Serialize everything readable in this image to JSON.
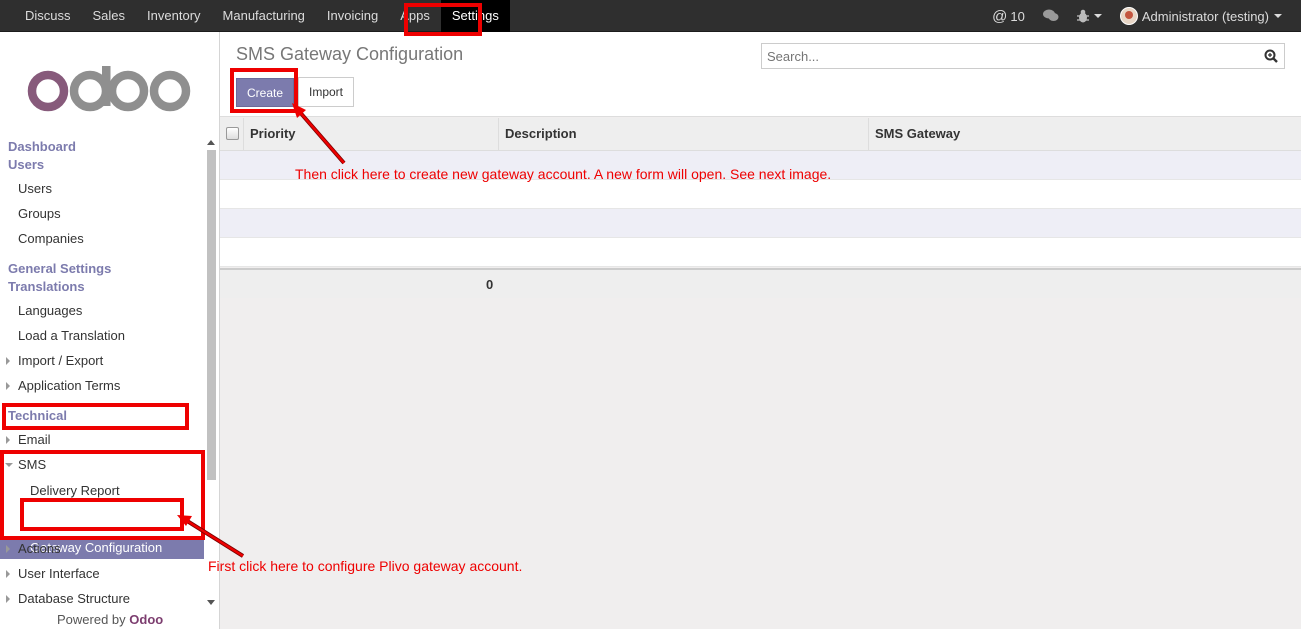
{
  "topbar": {
    "menu": [
      "Discuss",
      "Sales",
      "Inventory",
      "Manufacturing",
      "Invoicing",
      "Apps",
      "Settings"
    ],
    "active": "Settings",
    "mentions": "10",
    "user": "Administrator (testing)"
  },
  "sidebar": {
    "logo": "odoo",
    "dashboard": "Dashboard",
    "users_section": "Users",
    "users_items": [
      "Users",
      "Groups",
      "Companies"
    ],
    "general_settings": "General Settings",
    "translations_section": "Translations",
    "translations_items": [
      "Languages",
      "Load a Translation",
      "Import / Export",
      "Application Terms"
    ],
    "technical": "Technical",
    "email": "Email",
    "sms": "SMS",
    "sms_items": [
      "Delivery Report",
      "Gateway Configuration"
    ],
    "more_items": [
      "Actions",
      "User Interface",
      "Database Structure"
    ],
    "powered_by": "Powered by",
    "powered_brand": "Odoo"
  },
  "main": {
    "title": "SMS Gateway Configuration",
    "search_placeholder": "Search...",
    "create_label": "Create",
    "import_label": "Import",
    "columns": [
      "Priority",
      "Description",
      "SMS Gateway"
    ],
    "footer_total": "0"
  },
  "annotations": {
    "note_create": "Then click here to create new gateway account. A new form will open. See next image.",
    "note_gateway": "First click here to configure Plivo gateway account.",
    "color": "#e00000"
  },
  "colors": {
    "brand": "#7c7bad",
    "navbar": "#2f2f2f"
  }
}
